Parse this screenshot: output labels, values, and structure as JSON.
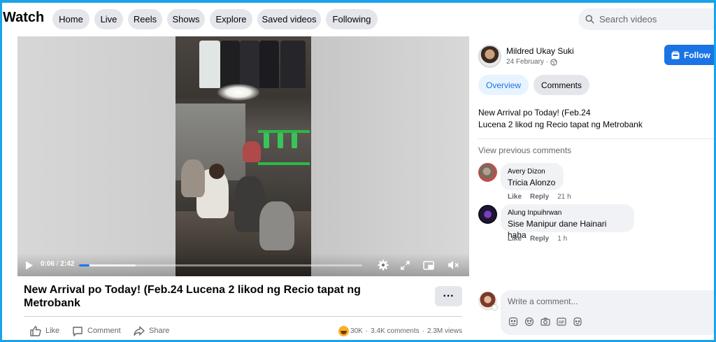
{
  "header": {
    "title": "Watch",
    "nav": [
      "Home",
      "Live",
      "Reels",
      "Shows",
      "Explore",
      "Saved videos",
      "Following"
    ],
    "search_placeholder": "Search videos"
  },
  "video": {
    "current_time": "0:06",
    "duration": "2:42",
    "progress": 0.037,
    "buffered": 0.2
  },
  "post": {
    "title": "New Arrival po Today! (Feb.24 Lucena 2 likod ng Recio tapat ng Metrobank",
    "more_label": "···",
    "actions": {
      "like": "Like",
      "comment": "Comment",
      "share": "Share"
    },
    "reactions_count": "30K",
    "comments_count": "3.4K comments",
    "views_count": "2.3M views",
    "separator": "·"
  },
  "sidebar": {
    "author": "Mildred Ukay Suki",
    "date": "24 February ·",
    "follow_label": "Follow",
    "tabs": [
      "Overview",
      "Comments"
    ],
    "description_lines": [
      "New Arrival po Today! (Feb.24",
      "Lucena 2 likod ng Recio tapat ng Metrobank"
    ],
    "view_previous": "View previous comments",
    "comments": [
      {
        "name": "Avery Dizon",
        "text": "Tricia Alonzo",
        "like": "Like",
        "reply": "Reply",
        "time": "21 h"
      },
      {
        "name": "Alung Inpuihrwan",
        "text": "Sise Manipur dane Hainari haha",
        "like": "Like",
        "reply": "Reply",
        "time": "1 h"
      }
    ],
    "write_placeholder": "Write a comment..."
  },
  "colors": {
    "accent": "#1b74e4",
    "frame_border": "#1aa3e8",
    "pill_bg": "#e4e6eb",
    "overview_tab_bg": "#e7f3ff"
  },
  "icons": [
    "search-icon",
    "play-icon",
    "settings-icon",
    "fullscreen-icon",
    "pip-icon",
    "mute-icon",
    "like-icon",
    "comment-icon",
    "share-icon",
    "haha-icon",
    "globe-icon",
    "follow-icon",
    "sticker-icon",
    "emoji-icon",
    "camera-icon",
    "gif-icon",
    "avatar-sticker-icon"
  ]
}
